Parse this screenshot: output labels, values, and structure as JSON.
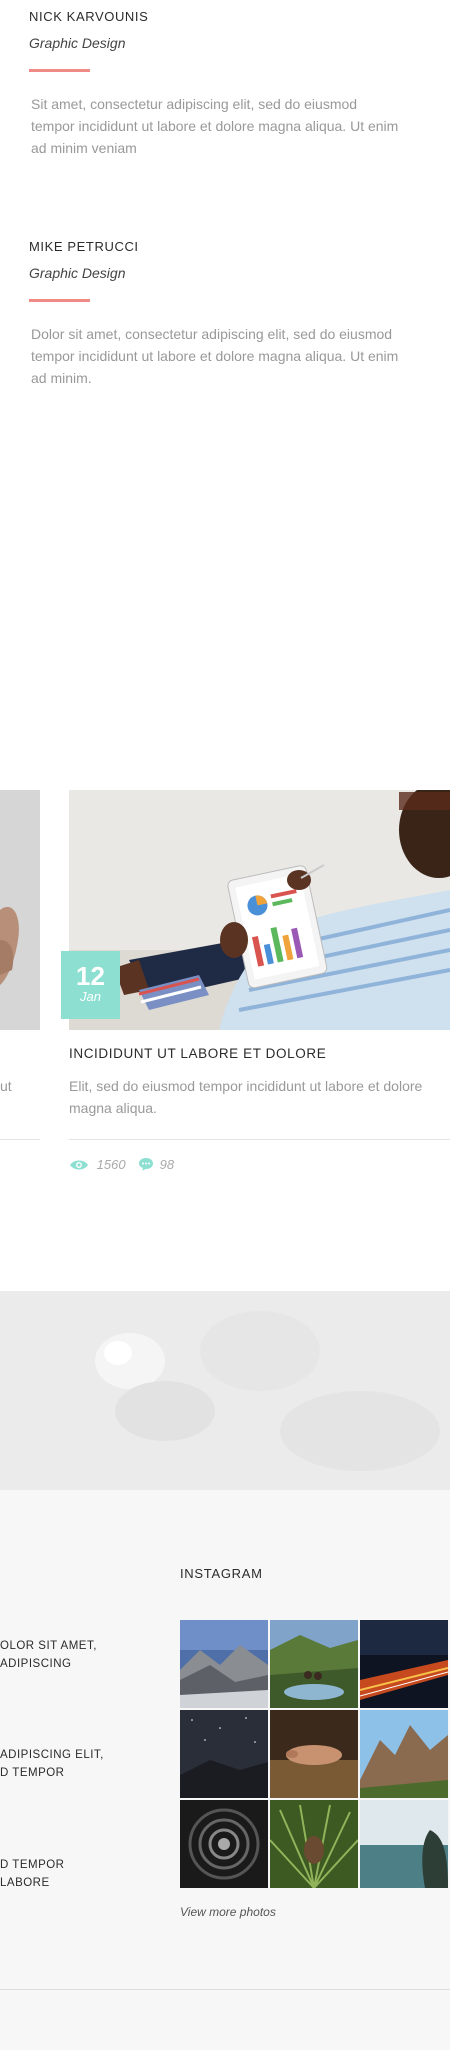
{
  "team": [
    {
      "name": "NICK KARVOUNIS",
      "role": "Graphic Design",
      "bio": "Sit amet, consectetur adipiscing elit, sed do eiusmod tempor incididunt ut labore et dolore magna aliqua. Ut enim ad minim veniam"
    },
    {
      "name": "MIKE PETRUCCI",
      "role": "Graphic Design",
      "bio": "Dolor sit amet, consectetur adipiscing elit, sed do eiusmod tempor incididunt ut labore et dolore magna aliqua. Ut enim ad minim."
    }
  ],
  "blog": {
    "partial_prev_text": "ut",
    "post": {
      "day": "12",
      "month": "Jan",
      "title": "INCIDIDUNT UT LABORE ET DOLORE",
      "excerpt": "Elit, sed do eiusmod tempor incididunt ut labore et dolore magna aliqua.",
      "views": "1560",
      "comments": "98"
    }
  },
  "footer": {
    "recent_posts": [
      {
        "line1": "OLOR SIT AMET,",
        "line2": "ADIPISCING"
      },
      {
        "line1": "ADIPISCING ELIT,",
        "line2": "D TEMPOR"
      },
      {
        "line1": "D TEMPOR",
        "line2": "LABORE"
      }
    ],
    "instagram": {
      "heading": "INSTAGRAM",
      "view_more": "View more photos",
      "photos": [
        "mountain-valley-photo",
        "forest-lake-photo",
        "night-highway-photo",
        "starry-night-photo",
        "hand-photo",
        "mountain-peak-photo",
        "tunnel-photo",
        "pinecone-photo",
        "sea-coast-photo"
      ]
    }
  },
  "colors": {
    "accent": "#ef8a86",
    "teal": "#8ddfd1"
  }
}
